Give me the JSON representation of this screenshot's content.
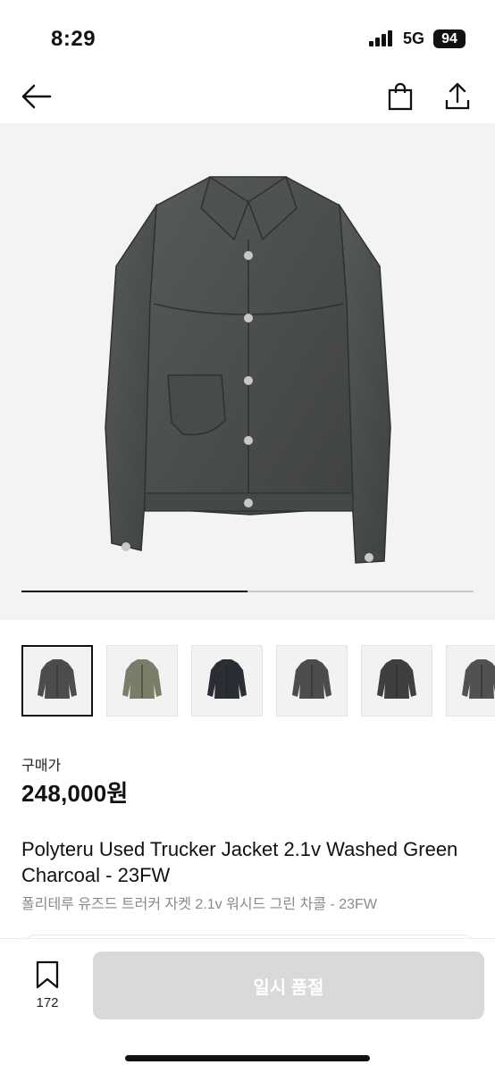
{
  "status_bar": {
    "time": "8:29",
    "network": "5G",
    "battery": "94"
  },
  "nav": {
    "back_icon": "back-arrow-icon",
    "bag_icon": "shopping-bag-icon",
    "share_icon": "share-icon"
  },
  "gallery": {
    "progress_fraction": 0.5,
    "thumbnails": [
      {
        "label": "charcoal-jacket",
        "selected": true
      },
      {
        "label": "camo-jacket",
        "selected": false
      },
      {
        "label": "black-jacket",
        "selected": false
      },
      {
        "label": "charcoal-jacket-2",
        "selected": false
      },
      {
        "label": "charcoal-jacket-3",
        "selected": false
      },
      {
        "label": "charcoal-jacket-4",
        "selected": false
      }
    ]
  },
  "product": {
    "price_label": "구매가",
    "price": "248,000원",
    "title": "Polyteru Used Trucker Jacket 2.1v Washed Green Charcoal - 23FW",
    "subtitle": "폴리테루 유즈드 트러커 자켓 2.1v 워시드 그린 차콜 - 23FW"
  },
  "bottom_bar": {
    "wishlist_count": "172",
    "buy_label": "일시 품절"
  },
  "colors": {
    "jacket": "#4a4d4b",
    "background": "#f3f3f3",
    "button_disabled": "#d9d9d9"
  }
}
